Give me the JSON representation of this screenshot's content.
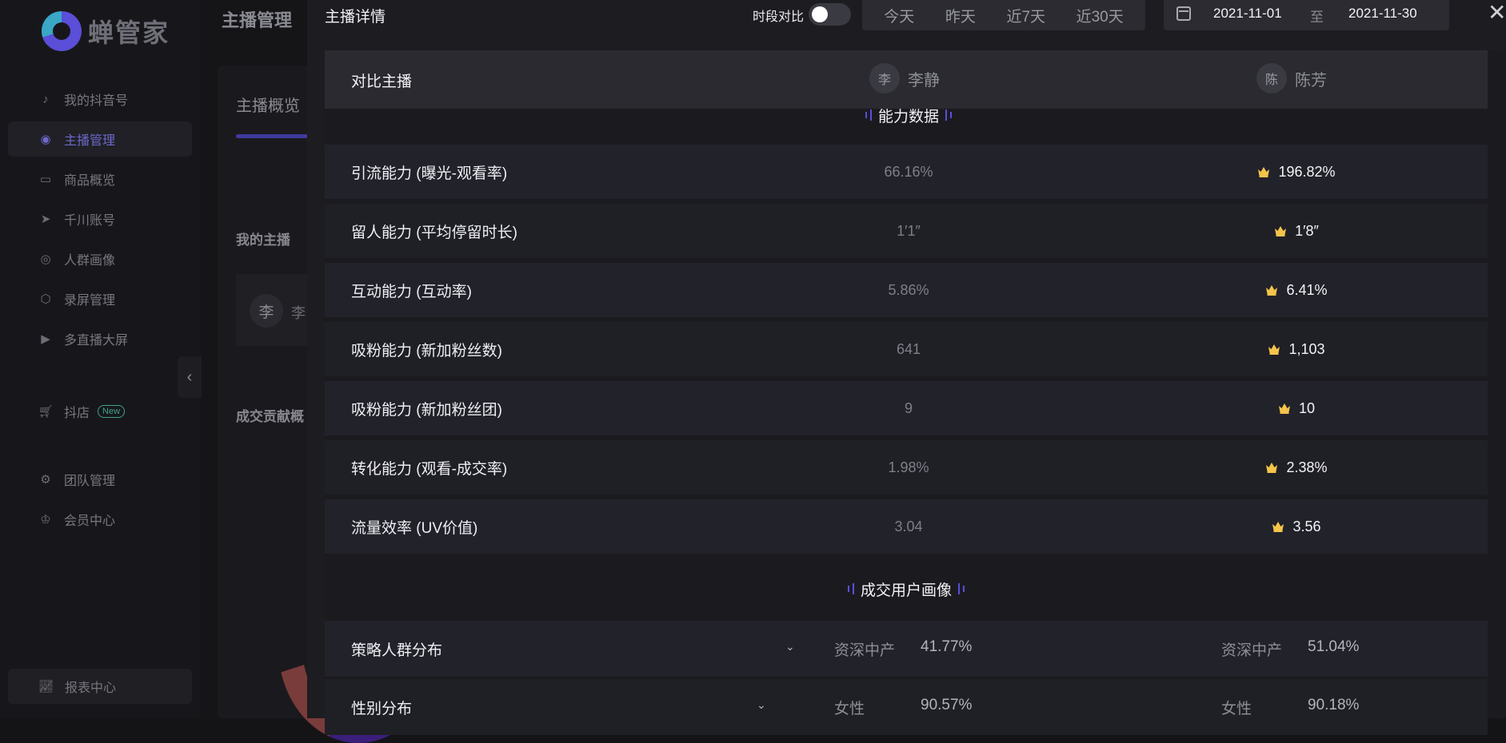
{
  "sidebar": {
    "logo_text": "蝉管家",
    "items": [
      {
        "label": "我的抖音号",
        "icon": "douyin-icon"
      },
      {
        "label": "主播管理",
        "icon": "user-circle-icon"
      },
      {
        "label": "商品概览",
        "icon": "bag-icon"
      },
      {
        "label": "千川账号",
        "icon": "send-icon"
      },
      {
        "label": "人群画像",
        "icon": "user-group-icon"
      },
      {
        "label": "录屏管理",
        "icon": "hexagon-icon"
      },
      {
        "label": "多直播大屏",
        "icon": "screen-icon"
      },
      {
        "label": "抖店",
        "icon": "cart-icon"
      },
      {
        "label": "团队管理",
        "icon": "gear-icon"
      },
      {
        "label": "会员中心",
        "icon": "crown-icon"
      }
    ],
    "shop_badge": "New",
    "report": "报表中心"
  },
  "bgpage": {
    "title": "主播管理",
    "tab": "主播概览",
    "my_anchor": "我的主播",
    "anchor_avatar": "李",
    "anchor_name_partial": "李",
    "contribution": "成交贡献概"
  },
  "drawer": {
    "title": "主播详情",
    "compare_label": "时段对比",
    "ranges": [
      "今天",
      "昨天",
      "近7天",
      "近30天"
    ],
    "date_start": "2021-11-01",
    "date_to": "至",
    "date_end": "2021-11-30",
    "compare_row": {
      "label": "对比主播",
      "a": {
        "avatar": "李",
        "name": "李静"
      },
      "b": {
        "avatar": "陈",
        "name": "陈芳"
      }
    },
    "ability_title": "能力数据",
    "metrics": [
      {
        "label": "引流能力 (曝光-观看率)",
        "a": "66.16%",
        "b": "196.82%"
      },
      {
        "label": "留人能力 (平均停留时长)",
        "a": "1′1″",
        "b": "1′8″"
      },
      {
        "label": "互动能力 (互动率)",
        "a": "5.86%",
        "b": "6.41%"
      },
      {
        "label": "吸粉能力 (新加粉丝数)",
        "a": "641",
        "b": "1,103"
      },
      {
        "label": "吸粉能力 (新加粉丝团)",
        "a": "9",
        "b": "10"
      },
      {
        "label": "转化能力 (观看-成交率)",
        "a": "1.98%",
        "b": "2.38%"
      },
      {
        "label": "流量效率 (UV价值)",
        "a": "3.04",
        "b": "3.56"
      }
    ],
    "persona_title": "成交用户画像",
    "distributions": [
      {
        "label": "策略人群分布",
        "a_key": "资深中产",
        "a_val": "41.77%",
        "b_key": "资深中产",
        "b_val": "51.04%"
      },
      {
        "label": "性别分布",
        "a_key": "女性",
        "a_val": "90.57%",
        "b_key": "女性",
        "b_val": "90.18%"
      }
    ]
  },
  "colors": {
    "accent": "#5a4ee0",
    "crown": "#f4c44a"
  }
}
